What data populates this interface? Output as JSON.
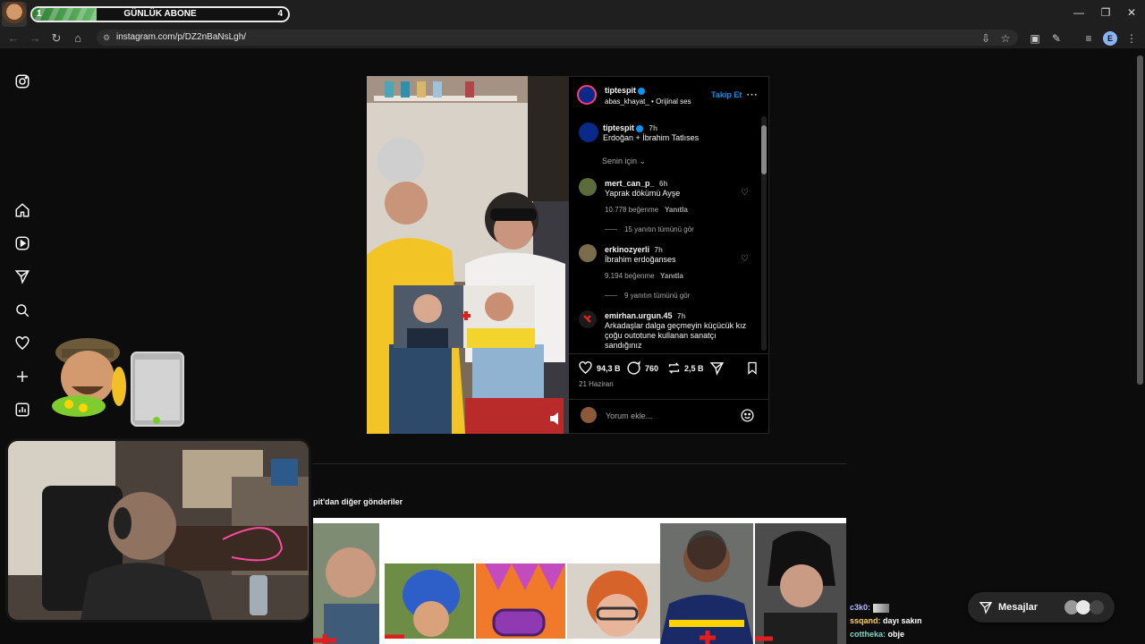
{
  "overlay": {
    "sub_goal_label": "GÜNLÜK ABONE",
    "sub_goal_start": "1",
    "sub_goal_end": "4",
    "progress_fraction": 0.25
  },
  "browser": {
    "url": "instagram.com/p/DZ2nBaNsLgh/",
    "profile_initial": "E"
  },
  "post": {
    "author": "tiptespit",
    "audio": "abas_khayat_ • Orijinal ses",
    "follow_label": "Takip Et",
    "caption_user": "tiptespit",
    "caption_time": "7h",
    "caption_text": "Erdoğan + İbrahim Tatlıses",
    "sort_label": "Senin için",
    "comments": [
      {
        "user": "mert_can_p_",
        "time": "6h",
        "text": "Yaprak dökümü Ayşe",
        "likes": "10.778 beğenme",
        "reply": "Yanıtla",
        "view_replies": "15 yanıtın tümünü gör"
      },
      {
        "user": "erkinozyerli",
        "time": "7h",
        "text": "İbrahim erdoğanses",
        "likes": "9.194 beğenme",
        "reply": "Yanıtla",
        "view_replies": "9 yanıtın tümünü gör"
      },
      {
        "user": "emirhan.urgun.45",
        "time": "7h",
        "text": "Arkadaşlar dalga geçmeyin küçücük kız çoğu outotune kullanan sanatçı sandığınız"
      }
    ],
    "likes_count": "94,3 B",
    "comments_count": "760",
    "reposts_count": "2,5 B",
    "date": "21 Haziran",
    "comment_placeholder": "Yorum ekle..."
  },
  "more_posts_label": "pit'dan diğer gönderiler",
  "chat": [
    {
      "user": "c3k0:",
      "user_color": "#b9b9ff",
      "text": ""
    },
    {
      "user": "ssqand:",
      "user_color": "#ffd24a",
      "text": "dayı sakın"
    },
    {
      "user": "cottheka:",
      "user_color": "#7ad7c6",
      "text": "obje"
    }
  ],
  "messages_label": "Mesajlar"
}
